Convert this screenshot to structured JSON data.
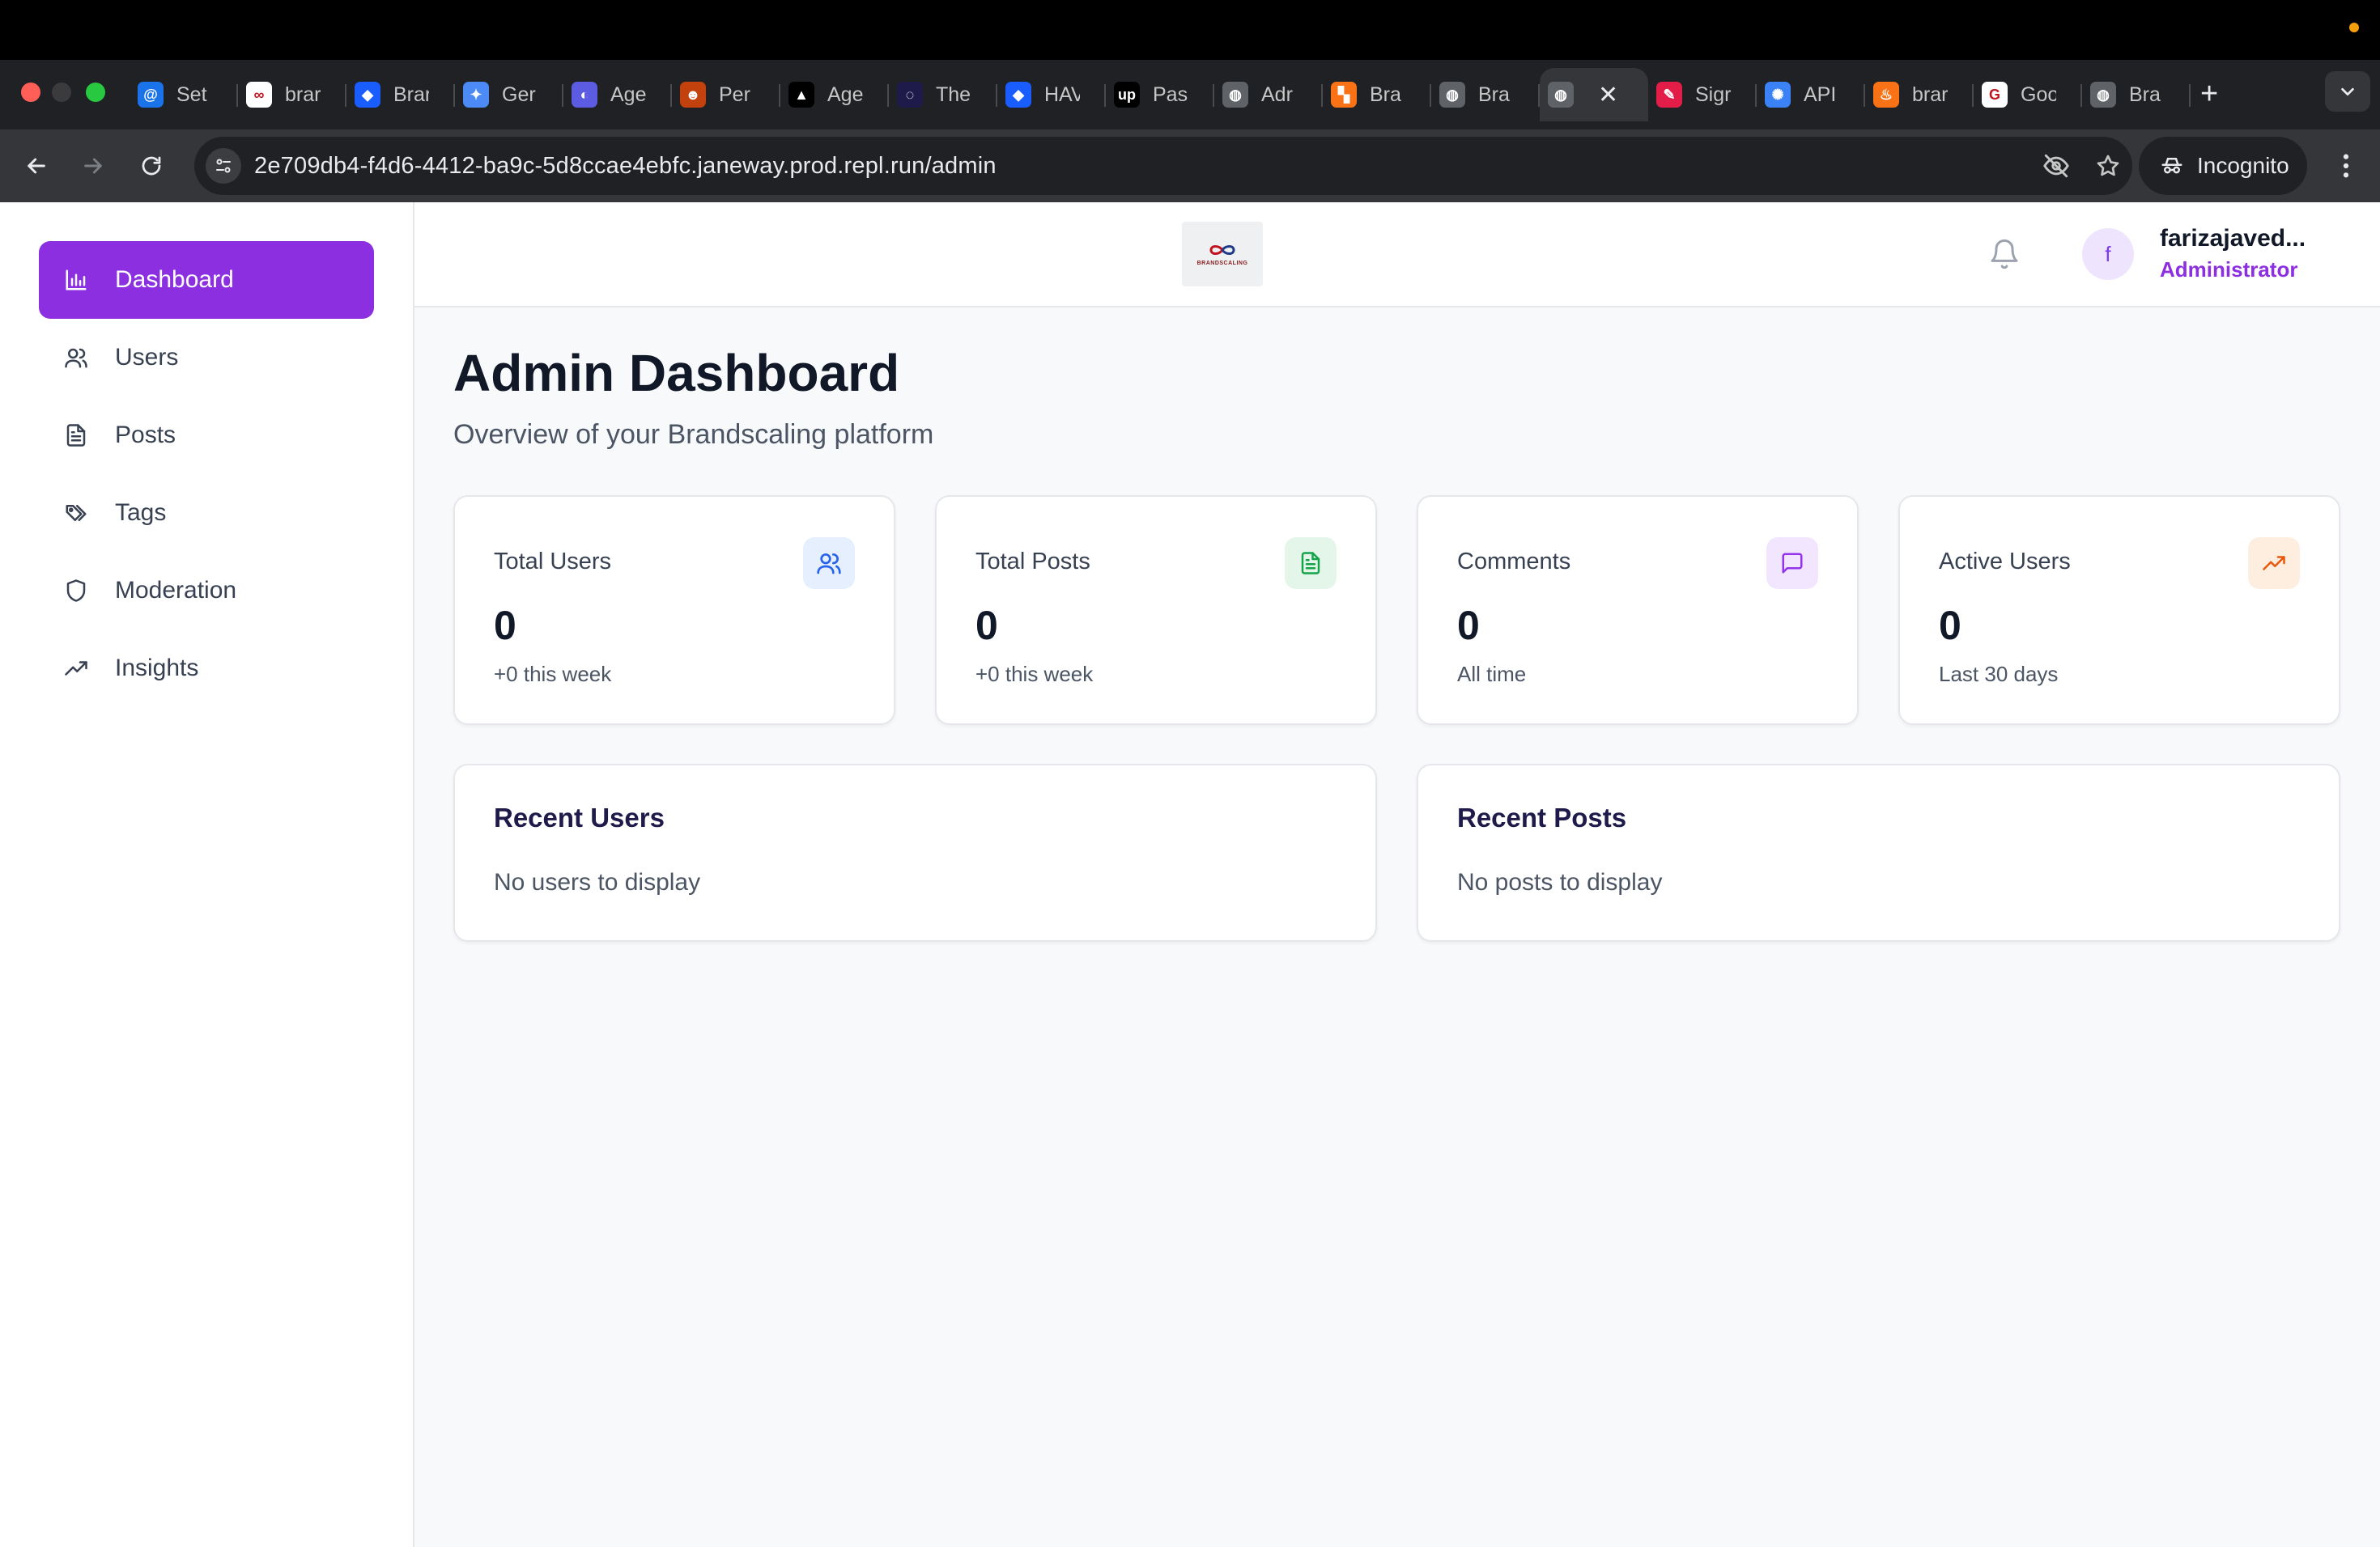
{
  "browser": {
    "tabs": [
      {
        "label": "Set",
        "icon": "spiral-icon",
        "color": "#1a73e8"
      },
      {
        "label": "brar",
        "icon": "brand-logo-icon",
        "color": "#ffffff"
      },
      {
        "label": "Brar",
        "icon": "dropbox-icon",
        "color": "#1a5dff"
      },
      {
        "label": "Ger",
        "icon": "sparkle-icon",
        "color": "#4c8bf5"
      },
      {
        "label": "Age",
        "icon": "agent-icon",
        "color": "#5b5ce2"
      },
      {
        "label": "Per",
        "icon": "avatar-icon",
        "color": "#c2410c"
      },
      {
        "label": "Age",
        "icon": "triangle-icon",
        "color": "#000000"
      },
      {
        "label": "The",
        "icon": "dark-circle-icon",
        "color": "#1e1b4b"
      },
      {
        "label": "HAV",
        "icon": "dropbox-icon",
        "color": "#1a5dff"
      },
      {
        "label": "Pas",
        "icon": "upwork-icon",
        "color": "#000000"
      },
      {
        "label": "Adr",
        "icon": "globe-icon",
        "color": "#5f6368"
      },
      {
        "label": "Bra",
        "icon": "grid-icon",
        "color": "#f97316"
      },
      {
        "label": "Bra",
        "icon": "globe-icon",
        "color": "#5f6368"
      },
      {
        "label": "",
        "icon": "globe-icon",
        "color": "#5f6368",
        "active": true
      },
      {
        "label": "Sigr",
        "icon": "sign-icon",
        "color": "#e11d48"
      },
      {
        "label": "API",
        "icon": "openai-icon",
        "color": "#3b82f6"
      },
      {
        "label": "brar",
        "icon": "flame-icon",
        "color": "#f97316"
      },
      {
        "label": "Goo",
        "icon": "google-icon",
        "color": "#ffffff"
      },
      {
        "label": "Bra",
        "icon": "globe-icon",
        "color": "#5f6368"
      }
    ],
    "close_glyph": "✕",
    "new_tab_glyph": "+",
    "url": "2e709db4-f4d6-4412-ba9c-5d8ccae4ebfc.janeway.prod.repl.run/admin",
    "incognito_label": "Incognito"
  },
  "sidebar": {
    "items": [
      {
        "label": "Dashboard",
        "icon": "bar-chart-icon",
        "active": true
      },
      {
        "label": "Users",
        "icon": "users-icon"
      },
      {
        "label": "Posts",
        "icon": "document-icon"
      },
      {
        "label": "Tags",
        "icon": "tags-icon"
      },
      {
        "label": "Moderation",
        "icon": "shield-icon"
      },
      {
        "label": "Insights",
        "icon": "trending-up-icon"
      }
    ]
  },
  "header": {
    "logo_text": "BRANDSCALING",
    "avatar_initial": "f",
    "user_name": "farizajaved...",
    "user_role": "Administrator"
  },
  "main": {
    "title": "Admin Dashboard",
    "subtitle": "Overview of your Brandscaling platform",
    "stats": [
      {
        "label": "Total Users",
        "value": "0",
        "note": "+0 this week",
        "icon": "users-icon",
        "icon_bg": "#e6effd",
        "icon_color": "#2563eb"
      },
      {
        "label": "Total Posts",
        "value": "0",
        "note": "+0 this week",
        "icon": "document-icon",
        "icon_bg": "#e3f6e9",
        "icon_color": "#16a34a"
      },
      {
        "label": "Comments",
        "value": "0",
        "note": "All time",
        "icon": "message-icon",
        "icon_bg": "#f1e6fd",
        "icon_color": "#9333ea"
      },
      {
        "label": "Active Users",
        "value": "0",
        "note": "Last 30 days",
        "icon": "trending-up-icon",
        "icon_bg": "#fdeee0",
        "icon_color": "#ea580c"
      }
    ],
    "recent_users": {
      "title": "Recent Users",
      "empty": "No users to display"
    },
    "recent_posts": {
      "title": "Recent Posts",
      "empty": "No posts to display"
    }
  },
  "colors": {
    "accent": "#8b2fe0",
    "chrome_dark": "#202124",
    "chrome_toolbar": "#35363a"
  }
}
